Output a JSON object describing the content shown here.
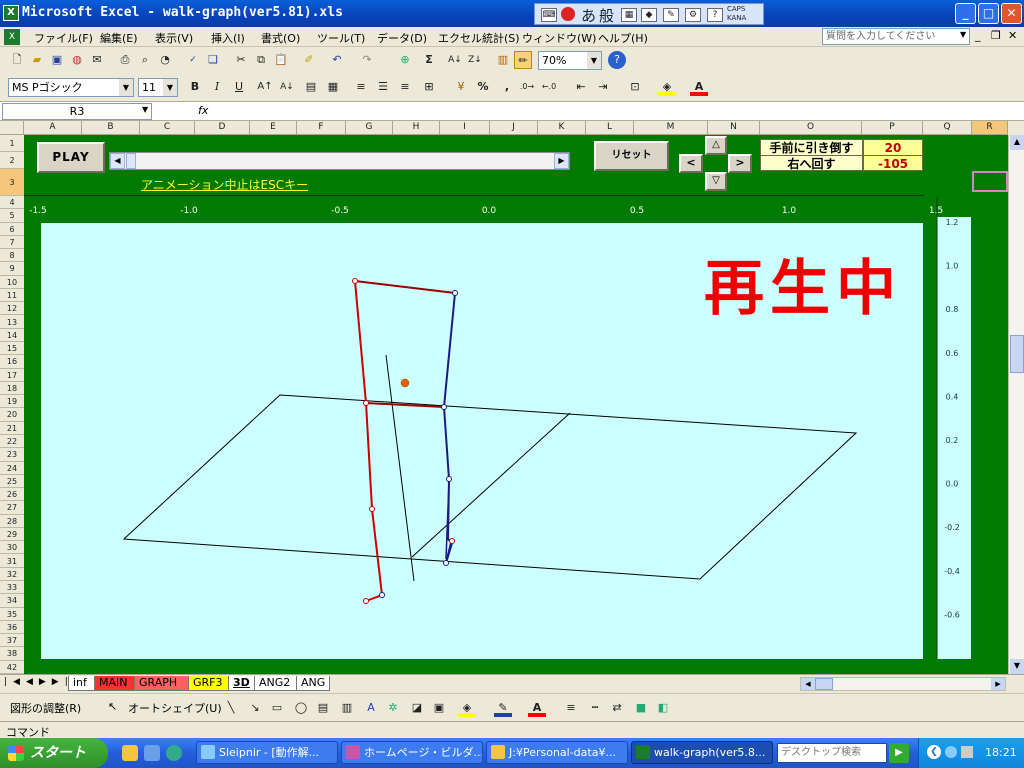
{
  "window": {
    "title": "Microsoft Excel - walk-graph(ver5.81).xls",
    "app_icon": "excel-icon",
    "ime": {
      "hira": "あ",
      "mode": "般",
      "caps": "CAPS",
      "kana": "KANA"
    },
    "controls": {
      "minimize": "_",
      "restore": "□",
      "close": "✕"
    }
  },
  "menu": {
    "items": [
      "ファイル(F)",
      "編集(E)",
      "表示(V)",
      "挿入(I)",
      "書式(O)",
      "ツール(T)",
      "データ(D)",
      "エクセル統計(S)",
      "ウィンドウ(W)",
      "ヘルプ(H)"
    ],
    "help_placeholder": "質問を入力してください"
  },
  "toolbar1": {
    "zoom": "70%",
    "icons": [
      "new-icon",
      "open-icon",
      "save-icon",
      "permission-icon",
      "email-icon",
      "print-icon",
      "preview-icon",
      "research-icon",
      "spelling-icon",
      "cut-icon",
      "copy-icon",
      "paste-icon",
      "format-painter-icon",
      "undo-icon",
      "redo-icon",
      "hyperlink-icon",
      "autosum-icon",
      "sort-asc-icon",
      "sort-desc-icon",
      "chart-wizard-icon",
      "drawing-icon",
      "help-icon"
    ]
  },
  "toolbar2": {
    "font": "MS Pゴシック",
    "size": "11",
    "bold": "B",
    "italic": "I",
    "underline": "U",
    "percent": "%",
    "comma": ","
  },
  "formula": {
    "name_box": "R3",
    "fx": "fx",
    "value": ""
  },
  "columns": [
    "A",
    "B",
    "C",
    "D",
    "E",
    "F",
    "G",
    "H",
    "I",
    "J",
    "K",
    "L",
    "M",
    "N",
    "O",
    "P",
    "Q",
    "R"
  ],
  "rows": [
    "1",
    "2",
    "3",
    "4",
    "5",
    "6",
    "7",
    "8",
    "9",
    "10",
    "11",
    "12",
    "13",
    "14",
    "15",
    "16",
    "17",
    "18",
    "19",
    "20",
    "21",
    "22",
    "23",
    "24",
    "25",
    "26",
    "27",
    "28",
    "29",
    "30",
    "31",
    "32",
    "33",
    "34",
    "35",
    "36",
    "37",
    "38",
    "42"
  ],
  "sheet": {
    "play_label": "PLAY",
    "reset_label": "リセット",
    "nav": {
      "up": "△",
      "down": "▽",
      "left": "<",
      "right": ">"
    },
    "esc_note": "アニメーション中止はESCキー",
    "pull_label": "手前に引き倒す",
    "pull_value": "20",
    "rotate_label": "右へ回す",
    "rotate_value": "-105",
    "status_overlay": "再生中"
  },
  "chart_data": {
    "type": "3d-line",
    "x_ticks": [
      "-1.5",
      "-1.0",
      "-0.5",
      "0.0",
      "0.5",
      "1.0",
      "1.5"
    ],
    "y_ticks": [
      "1.2",
      "1.0",
      "0.8",
      "0.6",
      "0.4",
      "0.2",
      "0.0",
      "-0.2",
      "-0.4",
      "-0.6"
    ],
    "colors": {
      "left_leg": "#cc0000",
      "right_leg": "#1a1a80",
      "pelvis": "#990000",
      "ground": "#000000",
      "center_of_mass": "#e06010",
      "plot_bg": "#ccffff"
    }
  },
  "sheet_tabs": [
    "inf",
    "MAIN",
    "GRAPH",
    "GRF3",
    "3D",
    "ANG2",
    "ANG"
  ],
  "sheet_tab_colors": {
    "MAIN": "#ff3030",
    "GRAPH": "#ff6060",
    "GRF3": "#ffff00",
    "3D": "#ffffff"
  },
  "drawbar": {
    "adjust": "図形の調整(R)",
    "autoshape": "オートシェイプ(U)"
  },
  "status": {
    "text": "コマンド"
  },
  "taskbar": {
    "start": "スタート",
    "tasks": [
      "Sleipnir - [動作解...",
      "ホームページ・ビルダ...",
      "J:¥Personal-data¥...",
      "walk-graph(ver5.8..."
    ],
    "search_placeholder": "デスクトップ検索",
    "clock": "18:21"
  }
}
